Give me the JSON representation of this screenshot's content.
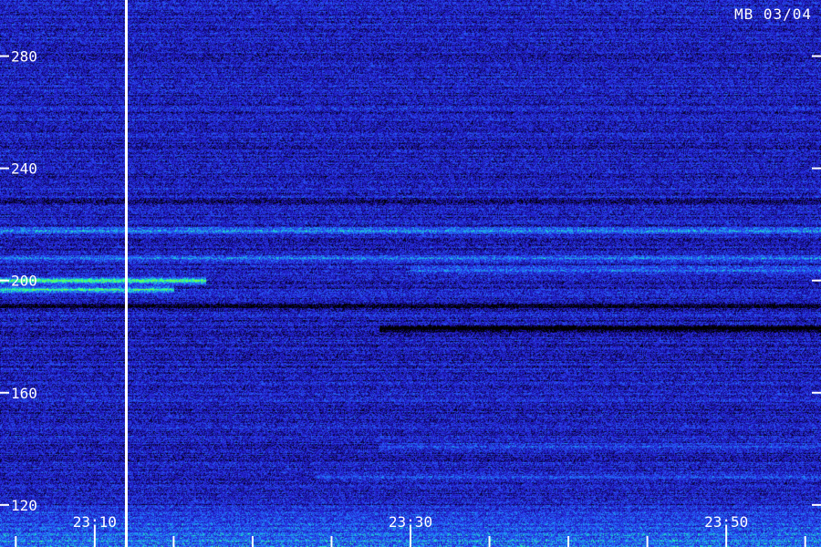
{
  "station_label": "MB 03/04",
  "chart_data": {
    "type": "heatmap",
    "title": "",
    "xlabel": "",
    "ylabel": "",
    "ylim": [
      105,
      300
    ],
    "xlim": [
      "23:04",
      "23:56"
    ],
    "y_ticks": [
      120,
      160,
      200,
      240,
      280
    ],
    "y_tick_labels": [
      "120",
      "160",
      "200",
      "240",
      "280"
    ],
    "x_major_ticks": [
      "23:10",
      "23:30",
      "23:50"
    ],
    "x_minor_ticks": [
      "23:05",
      "23:15",
      "23:20",
      "23:25",
      "23:35",
      "23:40",
      "23:45",
      "23:55"
    ],
    "marker_time": "23:12",
    "colormap": [
      "#000000",
      "#1a0fa8",
      "#2a36e8",
      "#1e88ff",
      "#22ffaa",
      "#7dff3a"
    ],
    "bands": [
      {
        "y": 200,
        "intensity": 0.95,
        "t_start": "23:04",
        "t_end": "23:17"
      },
      {
        "y": 197,
        "intensity": 0.75,
        "t_start": "23:04",
        "t_end": "23:15"
      },
      {
        "y": 218,
        "intensity": 0.45,
        "t_start": "23:04",
        "t_end": "23:56"
      },
      {
        "y": 208,
        "intensity": 0.4,
        "t_start": "23:04",
        "t_end": "23:56"
      },
      {
        "y": 204,
        "intensity": 0.35,
        "t_start": "23:30",
        "t_end": "23:56"
      },
      {
        "y": 191,
        "intensity": -0.6,
        "t_start": "23:04",
        "t_end": "23:56"
      },
      {
        "y": 183,
        "intensity": -0.9,
        "t_start": "23:28",
        "t_end": "23:56"
      },
      {
        "y": 141,
        "intensity": 0.3,
        "t_start": "23:28",
        "t_end": "23:56"
      },
      {
        "y": 130,
        "intensity": 0.25,
        "t_start": "23:24",
        "t_end": "23:56"
      },
      {
        "y": 228,
        "intensity": -0.4,
        "t_start": "23:04",
        "t_end": "23:56"
      }
    ]
  }
}
